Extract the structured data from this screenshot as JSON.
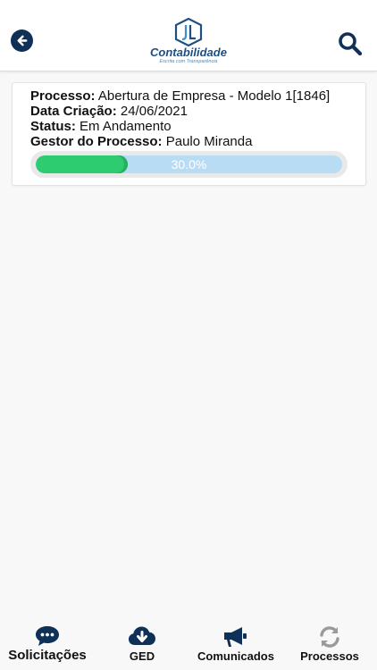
{
  "header": {
    "logo_name": "Contabilidade",
    "logo_tagline": "Escrita com Transparência",
    "back_icon": "arrow-left-circle-icon",
    "search_icon": "search-icon"
  },
  "process_card": {
    "process_label": "Processo:",
    "process_value": "Abertura de Empresa - Modelo 1[1846]",
    "date_label": "Data Criação:",
    "date_value": "24/06/2021",
    "status_label": "Status:",
    "status_value": "Em Andamento",
    "manager_label": "Gestor do Processo:",
    "manager_value": "Paulo Miranda",
    "progress_percent": 30.0,
    "progress_text": "30.0%"
  },
  "bottom_nav": {
    "items": [
      {
        "label": "Solicitações",
        "icon": "chat-bubble-icon"
      },
      {
        "label": "GED",
        "icon": "cloud-download-icon"
      },
      {
        "label": "Comunicados",
        "icon": "megaphone-icon"
      },
      {
        "label": "Processos",
        "icon": "sync-icon"
      }
    ]
  },
  "colors": {
    "primary": "#0f3057",
    "progress_fill": "#2ecc71",
    "progress_track": "#b9dcf5",
    "inactive_icon": "#9a9a9a"
  }
}
